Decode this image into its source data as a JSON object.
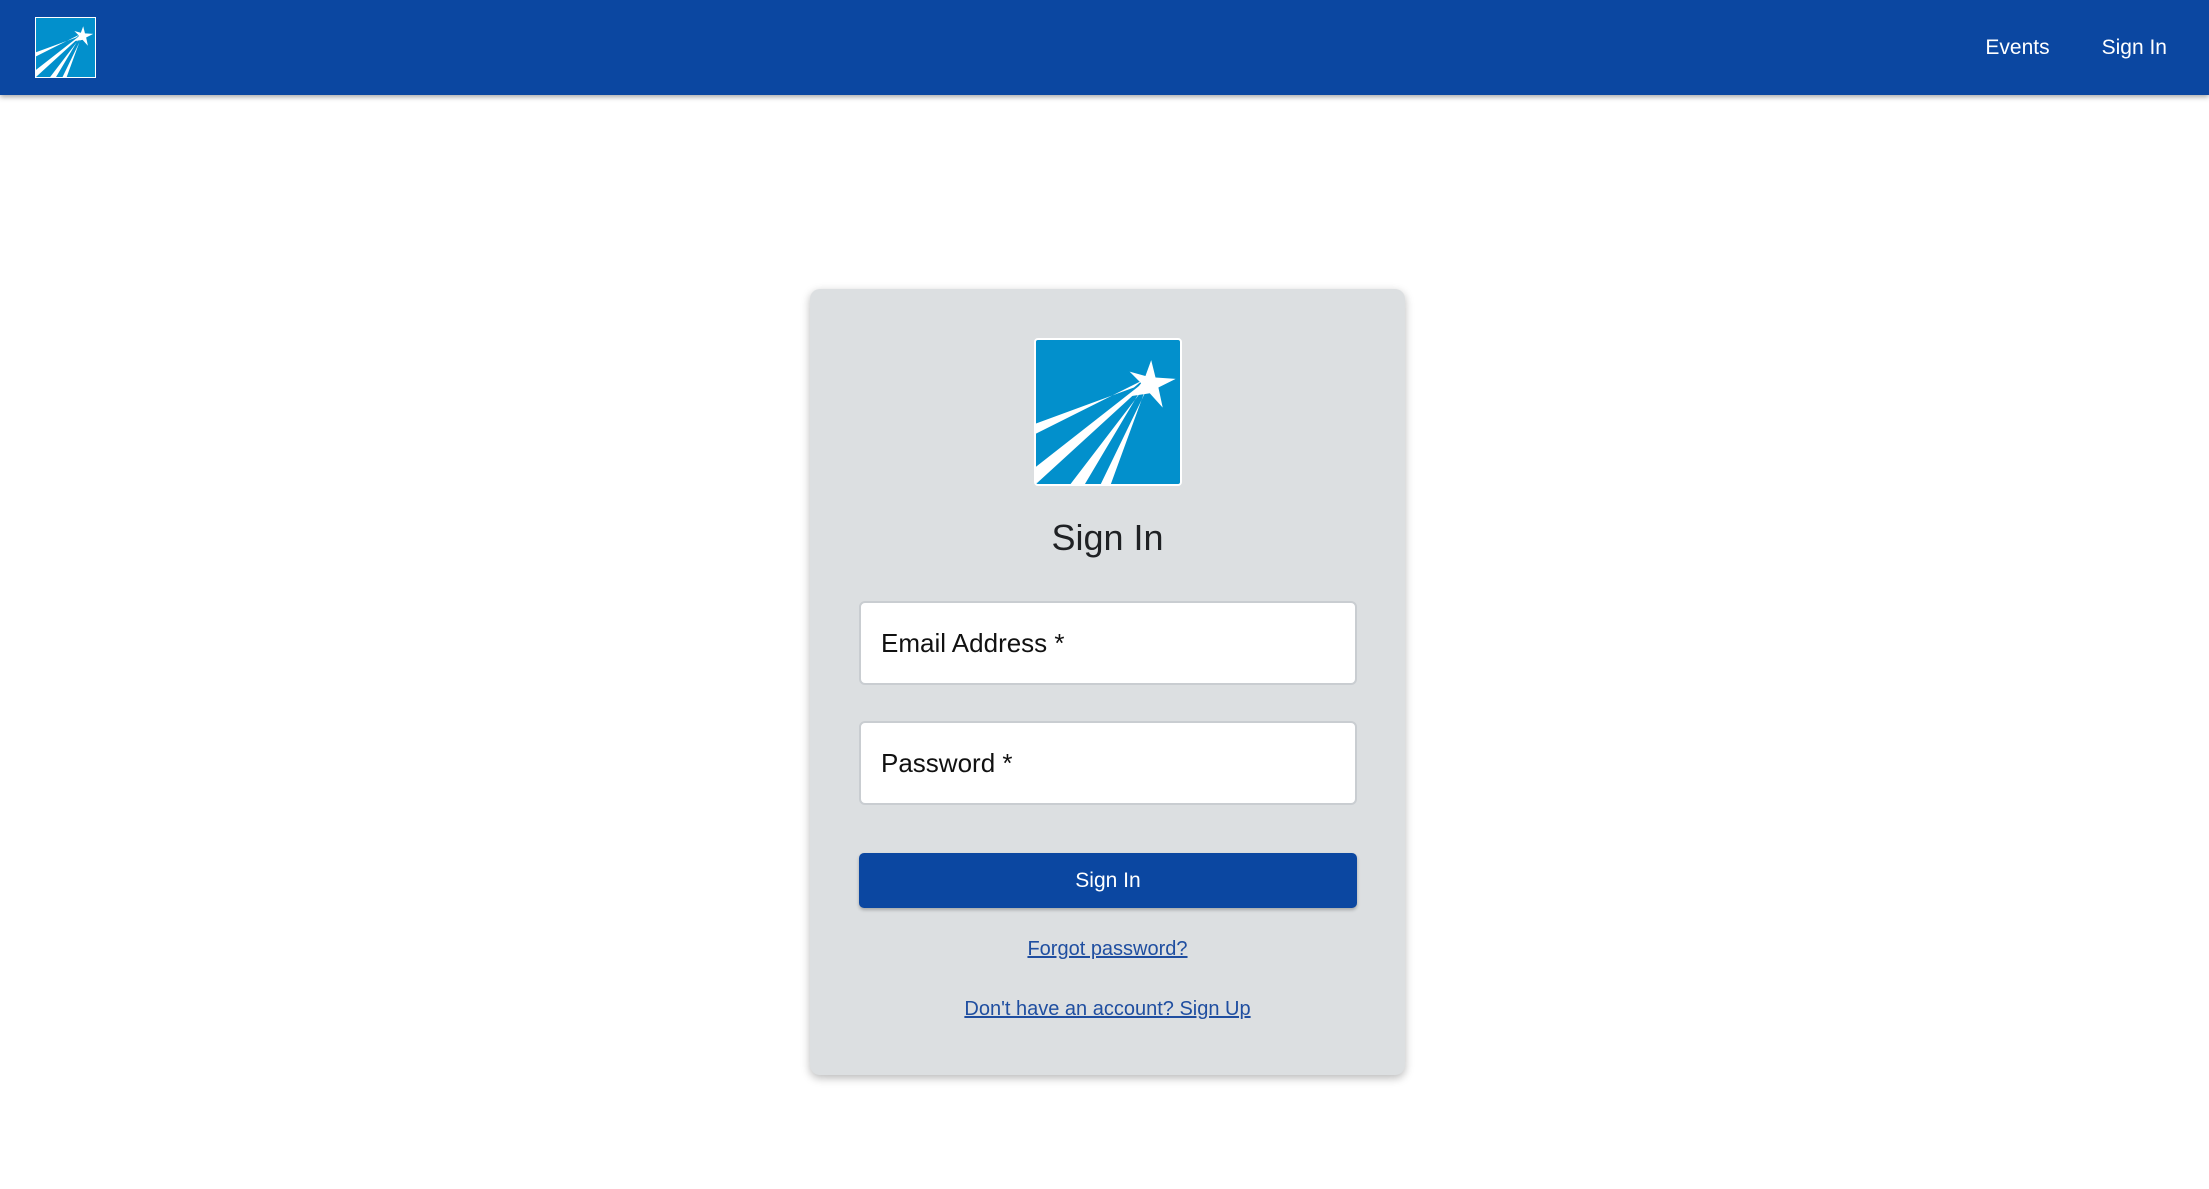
{
  "header": {
    "logo_icon": "shooting-star-logo-icon",
    "brand_color": "#0b47a1",
    "nav": [
      {
        "label": "Events"
      },
      {
        "label": "Sign In"
      }
    ]
  },
  "card": {
    "logo_icon": "shooting-star-logo-icon",
    "logo_color": "#0290cc",
    "title": "Sign In",
    "email": {
      "placeholder": "Email Address *",
      "value": ""
    },
    "password": {
      "placeholder": "Password *",
      "value": ""
    },
    "submit_label": "Sign In",
    "forgot_link": "Forgot password?",
    "signup_link": "Don't have an account? Sign Up"
  }
}
